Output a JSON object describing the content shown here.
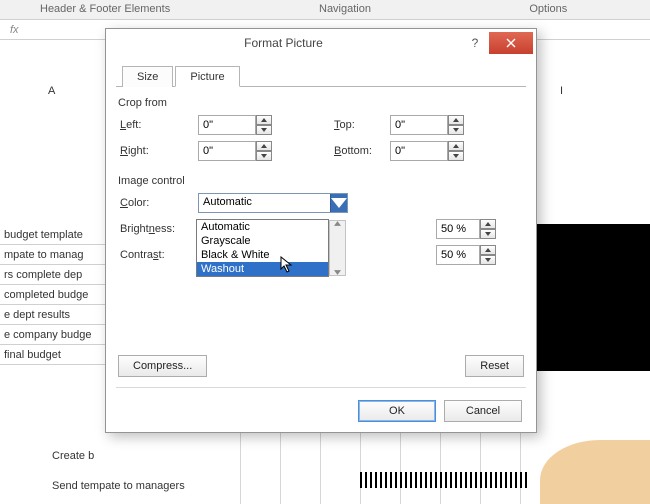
{
  "ribbon": {
    "group1": "Header & Footer Elements",
    "group2": "Navigation",
    "group3": "Options"
  },
  "fx": "fx",
  "columns": {
    "A": "A",
    "I": "I"
  },
  "tasks": [
    "budget template",
    "mpate to manag",
    "rs complete dep",
    "completed budge",
    "e dept results",
    "e company budge",
    "final budget",
    "Create b",
    "Send tempate to managers"
  ],
  "dialog": {
    "title": "Format Picture",
    "help": "?",
    "tabs": {
      "size": "Size",
      "picture": "Picture"
    },
    "crop": {
      "label": "Crop from",
      "left": "Left:",
      "left_val": "0\"",
      "right": "Right:",
      "right_val": "0\"",
      "top": "Top:",
      "top_val": "0\"",
      "bottom": "Bottom:",
      "bottom_val": "0\""
    },
    "image": {
      "label": "Image control",
      "color": "Color:",
      "color_val": "Automatic",
      "brightness": "Brightness:",
      "brightness_val": "50 %",
      "contrast": "Contrast:",
      "contrast_val": "50 %",
      "options": [
        "Automatic",
        "Grayscale",
        "Black & White",
        "Washout"
      ],
      "selected_index": 3
    },
    "buttons": {
      "compress": "Compress...",
      "reset": "Reset",
      "ok": "OK",
      "cancel": "Cancel"
    }
  }
}
